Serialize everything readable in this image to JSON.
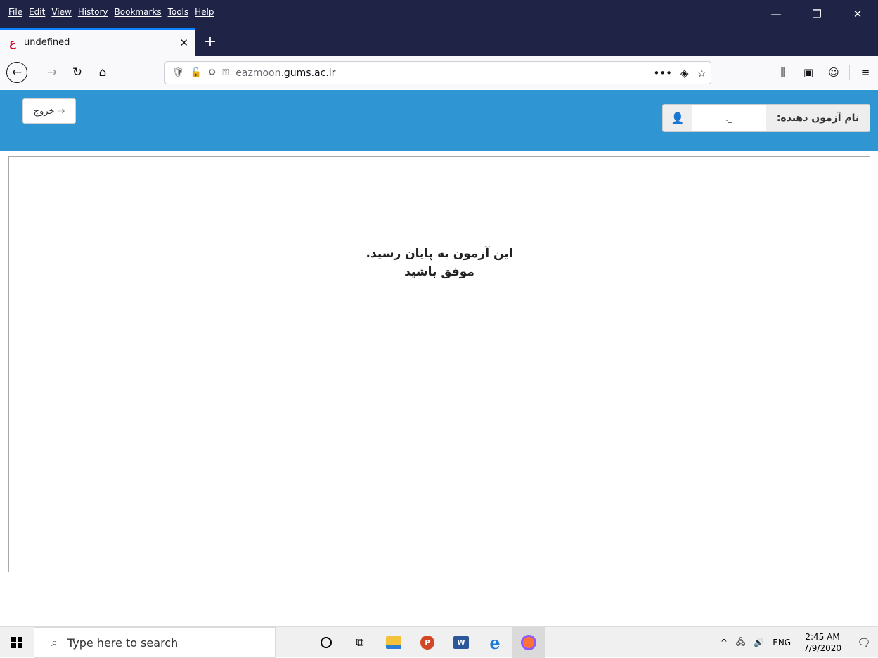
{
  "menu": [
    "File",
    "Edit",
    "View",
    "History",
    "Bookmarks",
    "Tools",
    "Help"
  ],
  "window_controls": {
    "minimize": "—",
    "restore": "❐",
    "close": "✕"
  },
  "tab": {
    "title": "undefined",
    "favicon": "ع",
    "close": "✕"
  },
  "newtab": "+",
  "nav": {
    "back": "←",
    "forward": "→",
    "reload": "↻",
    "home": "⌂"
  },
  "url": {
    "host_prefix": "eazmoon.",
    "domain": "gums.ac.ir",
    "shield_icon": "🛡",
    "insecure_icon": "🔓",
    "permissions_icon": "⚙",
    "key_icon": "⚿"
  },
  "url_actions": {
    "more": "•••",
    "pocket": "◈",
    "bookmark": "☆"
  },
  "toolbar_icons": {
    "library": "⫼",
    "sidebar": "▣",
    "account": "☺",
    "menu": "≡"
  },
  "header": {
    "exit_label": "خروج",
    "exit_icon": "⇨",
    "user_label": "نام آزمون دهنده:",
    "user_value": "._",
    "user_icon": "👤"
  },
  "message": {
    "line1": "این آزمون به پایان رسید.",
    "line2": "موفق باشید"
  },
  "taskbar": {
    "search_placeholder": "Type here to search",
    "search_icon": "⌕",
    "apps": [
      "cortana",
      "task-view",
      "file-explorer",
      "powerpoint",
      "word",
      "internet-explorer",
      "firefox"
    ],
    "tray_chevron": "^",
    "network_icon": "🖧",
    "volume_icon": "🔊",
    "language": "ENG",
    "time": "2:45 AM",
    "date": "7/9/2020",
    "notification_icon": "🗨"
  },
  "colors": {
    "titlebar": "#1f2345",
    "page_header": "#3096d3",
    "accent": "#0a84ff"
  }
}
